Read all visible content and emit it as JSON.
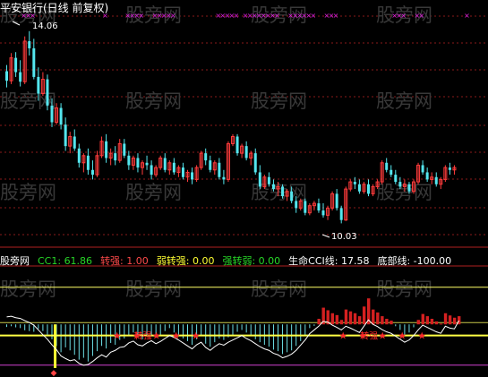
{
  "watermark": "股旁网",
  "header": {
    "title": "平安银行(日线 前复权)"
  },
  "price_labels": {
    "high": "14.06",
    "low": "10.03"
  },
  "indicator_bar": {
    "items": [
      {
        "label": "股旁网",
        "color": "#ffffff"
      },
      {
        "label": "CC1: 61.86",
        "color": "#27d827"
      },
      {
        "label": "转强: 1.00",
        "color": "#ff4a4a"
      },
      {
        "label": "弱转强: 0.00",
        "color": "#ffff33"
      },
      {
        "label": "强转弱: 0.00",
        "color": "#27d827"
      },
      {
        "label": "生命CCI线: 17.58",
        "color": "#ffffff"
      },
      {
        "label": "底部线: -100.00",
        "color": "#ffffff"
      }
    ]
  },
  "signal_labels": [
    "转强",
    "转强"
  ],
  "colors": {
    "up": "#ff3b3b",
    "down": "#54e6ee",
    "grid": "#8a1a1a",
    "top_marks": "#e020e0",
    "hline1": "#ffff66",
    "hline2": "#c8c84a",
    "hline3": "#d040d0"
  },
  "chart_data": {
    "type": "candlestick",
    "title": "平安银行(日线 前复权)",
    "price_axis": {
      "high_label": 14.06,
      "low_label": 10.03
    },
    "candles": [
      [
        13.22,
        13.35,
        12.88,
        13.02
      ],
      [
        13.02,
        13.6,
        12.95,
        13.5
      ],
      [
        13.5,
        13.62,
        13.1,
        13.2
      ],
      [
        13.2,
        13.45,
        12.9,
        13.0
      ],
      [
        13.0,
        13.95,
        12.95,
        13.85
      ],
      [
        13.85,
        14.06,
        13.55,
        13.7
      ],
      [
        13.7,
        13.9,
        13.05,
        13.1
      ],
      [
        13.1,
        13.3,
        12.6,
        12.75
      ],
      [
        12.75,
        13.2,
        12.7,
        13.05
      ],
      [
        13.05,
        13.15,
        12.4,
        12.5
      ],
      [
        12.5,
        12.65,
        12.05,
        12.15
      ],
      [
        12.15,
        12.55,
        12.1,
        12.45
      ],
      [
        12.45,
        12.55,
        12.0,
        12.1
      ],
      [
        12.1,
        12.25,
        11.55,
        11.65
      ],
      [
        11.65,
        11.95,
        11.5,
        11.85
      ],
      [
        11.85,
        12.0,
        11.55,
        11.6
      ],
      [
        11.6,
        11.7,
        11.2,
        11.3
      ],
      [
        11.3,
        11.5,
        11.1,
        11.45
      ],
      [
        11.45,
        11.6,
        11.05,
        11.15
      ],
      [
        11.15,
        11.35,
        10.95,
        11.05
      ],
      [
        11.05,
        11.55,
        11.0,
        11.45
      ],
      [
        11.45,
        11.85,
        11.4,
        11.75
      ],
      [
        11.75,
        11.9,
        11.3,
        11.4
      ],
      [
        11.4,
        11.6,
        11.25,
        11.5
      ],
      [
        11.5,
        11.65,
        11.25,
        11.35
      ],
      [
        11.35,
        11.8,
        11.3,
        11.7
      ],
      [
        11.7,
        11.8,
        11.4,
        11.45
      ],
      [
        11.45,
        11.55,
        11.15,
        11.25
      ],
      [
        11.25,
        11.45,
        11.15,
        11.4
      ],
      [
        11.4,
        11.5,
        11.1,
        11.2
      ],
      [
        11.2,
        11.35,
        11.05,
        11.3
      ],
      [
        11.3,
        11.45,
        11.15,
        11.25
      ],
      [
        11.25,
        11.35,
        10.95,
        11.05
      ],
      [
        11.05,
        11.25,
        11.0,
        11.2
      ],
      [
        11.2,
        11.45,
        11.15,
        11.4
      ],
      [
        11.4,
        11.5,
        11.1,
        11.15
      ],
      [
        11.15,
        11.35,
        11.05,
        11.3
      ],
      [
        11.3,
        11.4,
        11.05,
        11.1
      ],
      [
        11.1,
        11.25,
        11.0,
        11.2
      ],
      [
        11.2,
        11.3,
        10.95,
        11.0
      ],
      [
        11.0,
        11.15,
        10.9,
        11.1
      ],
      [
        11.1,
        11.2,
        10.85,
        10.95
      ],
      [
        10.95,
        11.25,
        10.9,
        11.2
      ],
      [
        11.2,
        11.55,
        11.15,
        11.5
      ],
      [
        11.5,
        11.6,
        11.25,
        11.35
      ],
      [
        11.35,
        11.45,
        11.1,
        11.15
      ],
      [
        11.15,
        11.35,
        11.05,
        11.3
      ],
      [
        11.3,
        11.4,
        10.95,
        11.0
      ],
      [
        11.0,
        11.15,
        10.85,
        10.95
      ],
      [
        10.95,
        11.75,
        10.9,
        11.7
      ],
      [
        11.7,
        11.9,
        11.65,
        11.85
      ],
      [
        11.85,
        11.9,
        11.45,
        11.5
      ],
      [
        11.5,
        11.7,
        11.4,
        11.65
      ],
      [
        11.65,
        11.75,
        11.35,
        11.4
      ],
      [
        11.4,
        11.55,
        11.25,
        11.5
      ],
      [
        11.5,
        11.6,
        11.05,
        11.1
      ],
      [
        11.1,
        11.25,
        10.75,
        10.8
      ],
      [
        10.8,
        11.05,
        10.75,
        11.0
      ],
      [
        11.0,
        11.1,
        10.8,
        10.85
      ],
      [
        10.85,
        10.95,
        10.7,
        10.75
      ],
      [
        10.75,
        10.9,
        10.6,
        10.8
      ],
      [
        10.8,
        10.85,
        10.55,
        10.6
      ],
      [
        10.6,
        10.75,
        10.5,
        10.7
      ],
      [
        10.7,
        10.8,
        10.45,
        10.5
      ],
      [
        10.5,
        10.6,
        10.25,
        10.35
      ],
      [
        10.35,
        10.55,
        10.3,
        10.5
      ],
      [
        10.5,
        10.55,
        10.2,
        10.25
      ],
      [
        10.25,
        10.45,
        10.2,
        10.4
      ],
      [
        10.4,
        10.5,
        10.3,
        10.45
      ],
      [
        10.45,
        10.55,
        10.25,
        10.3
      ],
      [
        10.3,
        10.45,
        10.15,
        10.2
      ],
      [
        10.2,
        10.4,
        10.1,
        10.35
      ],
      [
        10.35,
        10.7,
        10.3,
        10.65
      ],
      [
        10.65,
        10.75,
        10.3,
        10.35
      ],
      [
        10.35,
        10.4,
        10.03,
        10.1
      ],
      [
        10.1,
        10.8,
        10.08,
        10.75
      ],
      [
        10.75,
        10.95,
        10.7,
        10.9
      ],
      [
        10.9,
        11.0,
        10.75,
        10.85
      ],
      [
        10.85,
        10.95,
        10.65,
        10.7
      ],
      [
        10.7,
        10.9,
        10.65,
        10.85
      ],
      [
        10.85,
        10.95,
        10.6,
        10.65
      ],
      [
        10.65,
        10.85,
        10.6,
        10.8
      ],
      [
        10.8,
        10.95,
        10.75,
        10.9
      ],
      [
        10.9,
        11.35,
        10.85,
        11.3
      ],
      [
        11.3,
        11.4,
        11.1,
        11.15
      ],
      [
        11.15,
        11.25,
        11.0,
        11.05
      ],
      [
        11.05,
        11.15,
        10.85,
        10.9
      ],
      [
        10.9,
        11.0,
        10.75,
        10.8
      ],
      [
        10.8,
        10.95,
        10.7,
        10.85
      ],
      [
        10.85,
        10.9,
        10.65,
        10.7
      ],
      [
        10.7,
        10.95,
        10.65,
        10.9
      ],
      [
        10.9,
        11.3,
        10.85,
        11.25
      ],
      [
        11.25,
        11.35,
        11.05,
        11.1
      ],
      [
        11.1,
        11.2,
        10.9,
        10.95
      ],
      [
        10.95,
        11.1,
        10.85,
        11.0
      ],
      [
        11.0,
        11.1,
        10.8,
        10.85
      ],
      [
        10.85,
        11.0,
        10.75,
        10.95
      ],
      [
        10.95,
        11.25,
        10.9,
        11.2
      ],
      [
        11.2,
        11.3,
        11.05,
        11.15
      ],
      [
        11.15,
        11.25,
        11.05,
        11.2
      ]
    ],
    "cci_bars": [
      -7,
      -5,
      -8,
      -10,
      -16,
      -18,
      -20,
      -12,
      -18,
      -28,
      -40,
      -58,
      -75,
      -62,
      -70,
      -82,
      -95,
      -90,
      -100,
      -85,
      -72,
      -58,
      -65,
      -50,
      -55,
      -42,
      -38,
      -30,
      -22,
      -35,
      -40,
      -32,
      -28,
      -36,
      -30,
      -18,
      -10,
      -22,
      -30,
      -38,
      -45,
      -55,
      -40,
      -30,
      -52,
      -60,
      -48,
      -38,
      -42,
      -35,
      -28,
      -20,
      -15,
      -22,
      -30,
      -40,
      -48,
      -55,
      -60,
      -68,
      -72,
      -80,
      -75,
      -70,
      -58,
      -45,
      -30,
      -10,
      -4,
      15,
      45,
      38,
      30,
      25,
      12,
      40,
      35,
      30,
      22,
      48,
      70,
      40,
      32,
      22,
      15,
      10,
      -5,
      -15,
      -30,
      -22,
      -8,
      12,
      28,
      22,
      15,
      8,
      2,
      30,
      24,
      18,
      22
    ],
    "cci_line": [
      20,
      22,
      18,
      16,
      10,
      5,
      -2,
      -15,
      -28,
      -40,
      -55,
      -68,
      -85,
      -92,
      -98,
      -95,
      -105,
      -110,
      -108,
      -100,
      -90,
      -82,
      -88,
      -75,
      -70,
      -62,
      -60,
      -50,
      -45,
      -55,
      -58,
      -50,
      -44,
      -52,
      -46,
      -38,
      -30,
      -35,
      -42,
      -50,
      -58,
      -66,
      -55,
      -48,
      -62,
      -70,
      -60,
      -52,
      -56,
      -48,
      -42,
      -36,
      -30,
      -38,
      -44,
      -52,
      -60,
      -66,
      -70,
      -78,
      -82,
      -90,
      -86,
      -80,
      -70,
      -56,
      -42,
      -25,
      -15,
      -5,
      8,
      6,
      -2,
      -8,
      -15,
      -5,
      -10,
      -16,
      -22,
      -5,
      12,
      0,
      -6,
      -14,
      -20,
      -24,
      -32,
      -40,
      -48,
      -42,
      -30,
      -15,
      -2,
      -8,
      -14,
      -20,
      -24,
      -5,
      -10,
      -12,
      10
    ],
    "levels": {
      "line1": 100,
      "line2": 0,
      "line3": -100
    },
    "signals": [
      34,
      84
    ],
    "pane_range": [
      -120,
      150
    ]
  }
}
